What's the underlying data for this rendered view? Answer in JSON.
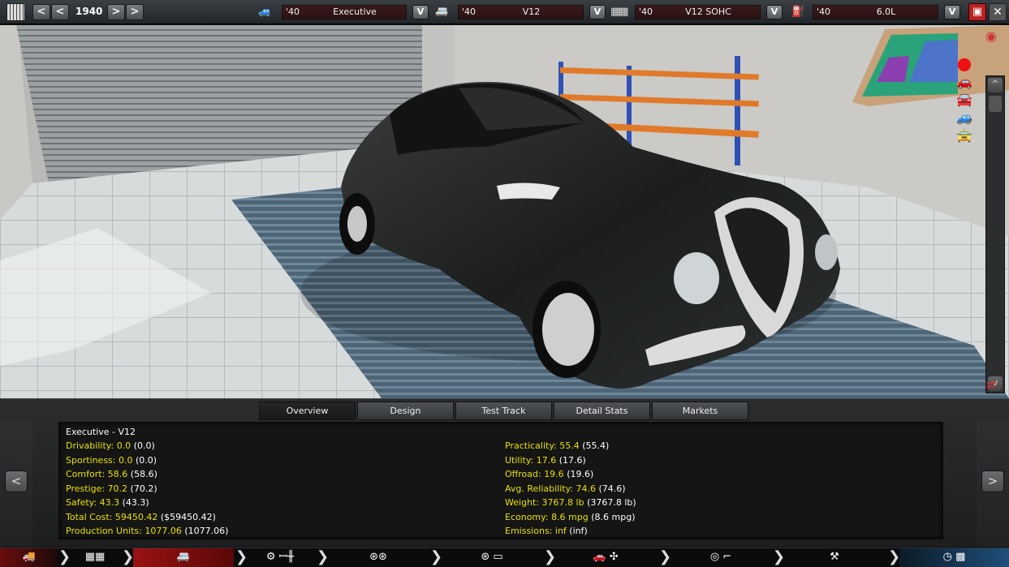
{
  "topbar": {
    "year": "1940",
    "fields": [
      {
        "icon": "car-body-icon",
        "year": "'40",
        "value": "Executive"
      },
      {
        "icon": "car-model-icon",
        "year": "'40",
        "value": "V12"
      },
      {
        "icon": "engine-icon",
        "year": "'40",
        "value": "V12 SOHC"
      },
      {
        "icon": "engine-variant-icon",
        "year": "'40",
        "value": "6.0L"
      }
    ],
    "dropdown_label": "V",
    "prev_label": "<",
    "next_label": ">"
  },
  "tabs": [
    "Overview",
    "Design",
    "Test Track",
    "Detail Stats",
    "Markets"
  ],
  "active_tab": "Overview",
  "stats": {
    "title": "Executive - V12",
    "left": [
      {
        "label": "Drivability:",
        "value": "0.0",
        "paren": "(0.0)"
      },
      {
        "label": "Sportiness:",
        "value": "0.0",
        "paren": "(0.0)"
      },
      {
        "label": "Comfort:",
        "value": "58.6",
        "paren": "(58.6)"
      },
      {
        "label": "Prestige:",
        "value": "70.2",
        "paren": "(70.2)"
      },
      {
        "label": "Safety:",
        "value": "43.3",
        "paren": "(43.3)"
      },
      {
        "label": "Total Cost:",
        "value": "59450.42",
        "paren": "($59450.42)"
      },
      {
        "label": "Production Units:",
        "value": "1077.06",
        "paren": "(1077.06)"
      }
    ],
    "right": [
      {
        "label": "Practicality:",
        "value": "55.4",
        "paren": "(55.4)"
      },
      {
        "label": "Utility:",
        "value": "17.6",
        "paren": "(17.6)"
      },
      {
        "label": "Offroad:",
        "value": "19.6",
        "paren": "(19.6)"
      },
      {
        "label": "Avg. Reliability:",
        "value": "74.6",
        "paren": "(74.6)"
      },
      {
        "label": "Weight:",
        "value": "3767.8 lb",
        "paren": "(3767.8 lb)"
      },
      {
        "label": "Economy:",
        "value": "8.6 mpg",
        "paren": "(8.6 mpg)"
      },
      {
        "label": "Emissions:",
        "value": "inf",
        "paren": "(inf)"
      }
    ]
  },
  "panel_nav": {
    "prev": "<",
    "next": ">"
  },
  "scroll": {
    "up": "^",
    "down": "v"
  },
  "colors": {
    "stat_value": "#e8e000",
    "active_nav": "#8a1010",
    "final_nav": "#1f4f7a"
  }
}
